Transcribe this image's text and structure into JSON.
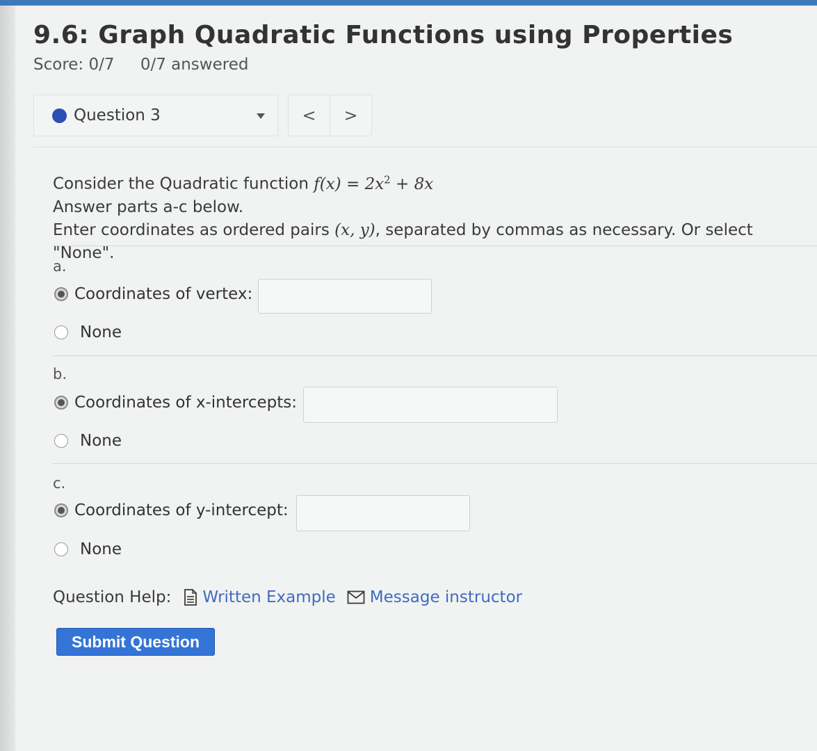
{
  "assignment": {
    "title": "9.6: Graph Quadratic Functions using Properties",
    "score": "Score: 0/7",
    "answered": "0/7 answered"
  },
  "question_nav": {
    "current": "Question 3",
    "prev_symbol": "<",
    "next_symbol": ">",
    "status_color": "#2a4fb5"
  },
  "prompt": {
    "lead": "Consider the Quadratic function ",
    "function_lhs": "f(x)",
    "equals": " = ",
    "function_coef": "2x",
    "exponent": "2",
    "function_tail": " + 8x",
    "line2": "Answer parts a-c below.",
    "line3_lead": "Enter coordinates as ordered pairs ",
    "ordered_pair": "(x, y)",
    "line3_tail": ", separated by commas as necessary. Or select \"None\"."
  },
  "parts": [
    {
      "letter": "a.",
      "option_label": "Coordinates of vertex:",
      "none_label": "None",
      "value": ""
    },
    {
      "letter": "b.",
      "option_label": "Coordinates of x-intercepts:",
      "none_label": "None",
      "value": ""
    },
    {
      "letter": "c.",
      "option_label": "Coordinates of y-intercept:",
      "none_label": "None",
      "value": ""
    }
  ],
  "help": {
    "label": "Question Help:",
    "written_example": "Written Example",
    "message_instructor": "Message instructor"
  },
  "submit_label": "Submit Question",
  "colors": {
    "accent": "#3474d6",
    "link": "#3f6cc0"
  }
}
